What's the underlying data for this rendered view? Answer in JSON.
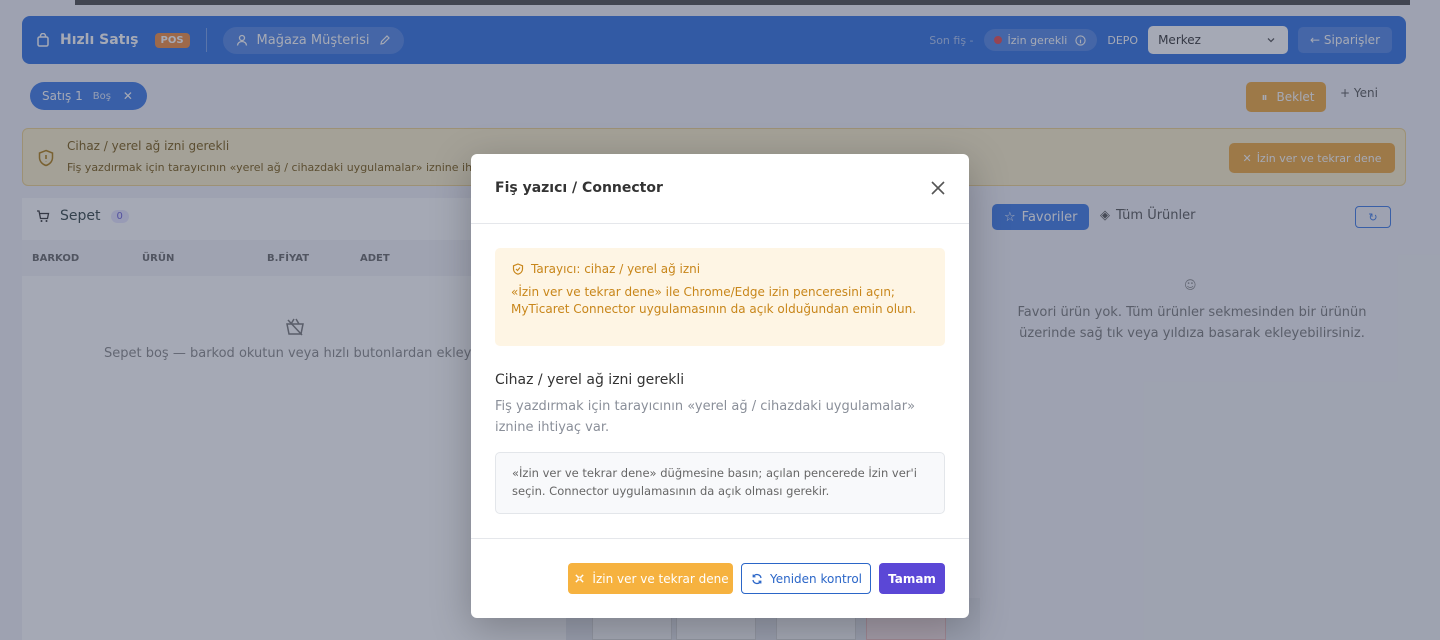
{
  "header": {
    "title": "Hızlı Satış",
    "pos_badge": "POS",
    "customer": "Mağaza Müşterisi",
    "last_receipt": "Son fiş -",
    "permission_status": "İzin gerekli",
    "depo_label": "DEPO",
    "depo_value": "Merkez",
    "orders_label": "Siparişler"
  },
  "tabs": {
    "sale_tab_label": "Satış 1",
    "sale_tab_status": "Boş",
    "wait_label": "Beklet",
    "new_label": "Yeni"
  },
  "alert_bar": {
    "title": "Cihaz / yerel ağ izni gerekli",
    "text": "Fiş yazdırmak için tarayıcının «yerel ağ / cihazdaki uygulamalar» iznine ih",
    "button": "İzin ver ve tekrar dene"
  },
  "cart": {
    "title": "Sepet",
    "count": "0",
    "columns": [
      "BARKOD",
      "ÜRÜN",
      "B.FİYAT",
      "ADET"
    ],
    "empty_text": "Sepet boş — barkod okutun veya hızlı butonlardan ekley"
  },
  "products": {
    "tab_favorites": "Favoriler",
    "tab_all": "Tüm Ürünler",
    "empty_text": "Favori ürün yok. Tüm ürünler sekmesinden bir ürünün üzerinde sağ tık veya yıldıza basarak ekleyebilirsiniz."
  },
  "modal": {
    "title": "Fiş yazıcı / Connector",
    "warning_title": "Tarayıcı: cihaz / yerel ağ izni",
    "warning_text": "«İzin ver ve tekrar dene» ile Chrome/Edge izin penceresini açın; MyTicaret Connector uygulamasının da açık olduğundan emin olun.",
    "section_title": "Cihaz / yerel ağ izni gerekli",
    "section_desc": "Fiş yazdırmak için tarayıcının «yerel ağ / cihazdaki uygulamalar» iznine ihtiyaç var.",
    "info_text": "«İzin ver ve tekrar dene» düğmesine basın; açılan pencerede İzin ver'i seçin. Connector uygulamasının da açık olması gerekir.",
    "btn_allow_retry": "İzin ver ve tekrar dene",
    "btn_recheck": "Yeniden kontrol",
    "btn_ok": "Tamam"
  },
  "colors": {
    "header_blue": "#2f6fe0",
    "warning_text": "#c8861a",
    "warning_bg": "#fef5e4",
    "button_orange": "#f6b23f",
    "button_purple": "#5b47d6",
    "outline_blue": "#2b66c8"
  },
  "icons": [
    "shop-icon",
    "user-icon",
    "edit-icon",
    "info-icon",
    "chevron-down-icon",
    "arrow-left-icon",
    "close-icon",
    "pause-icon",
    "plus-icon",
    "shield-icon",
    "cart-icon",
    "empty-basket-icon",
    "star-icon",
    "box-icon",
    "refresh-icon",
    "smile-icon",
    "plug-icon"
  ]
}
